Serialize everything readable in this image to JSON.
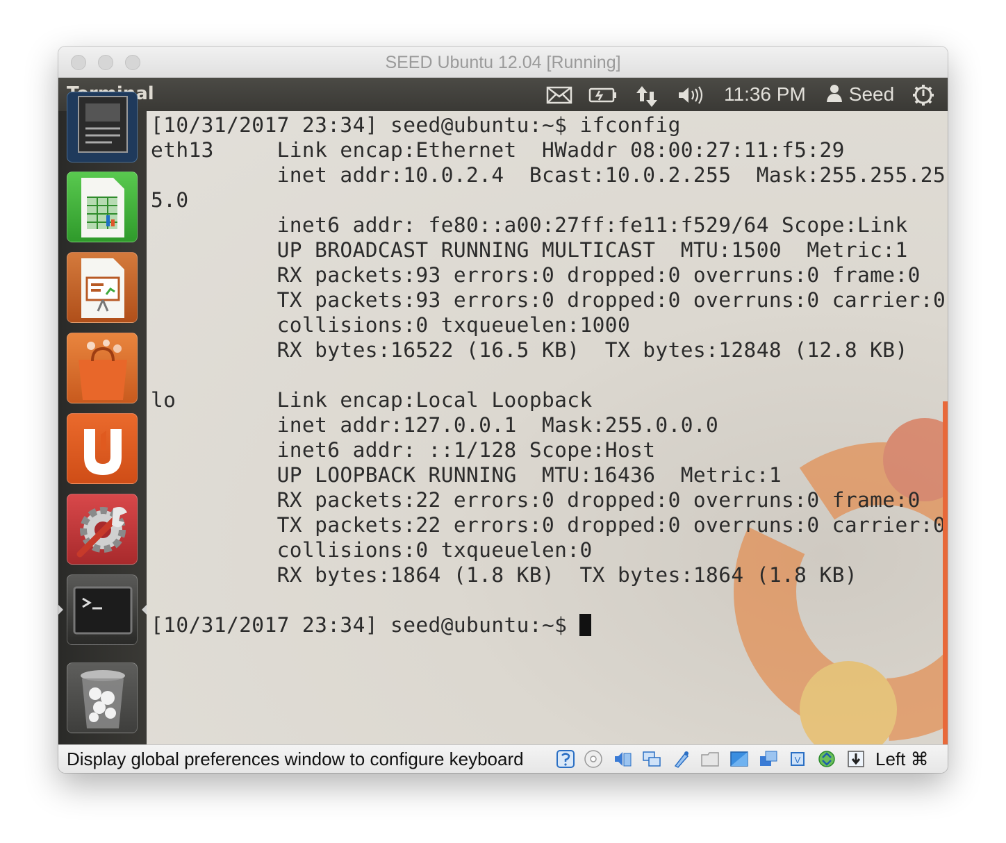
{
  "window": {
    "title": "SEED Ubuntu 12.04 [Running]"
  },
  "panel": {
    "app_title": "Terminal",
    "indicators": [
      "mail-icon",
      "battery-icon",
      "network-icon",
      "volume-icon"
    ],
    "clock": "11:36 PM",
    "user": "Seed",
    "session_icon": "power-gear-icon"
  },
  "launcher": {
    "items": [
      "document-viewer",
      "libreoffice-calc",
      "libreoffice-impress",
      "software-center",
      "ubuntu-one",
      "system-settings",
      "terminal",
      "trash"
    ],
    "colors": {
      "calc": "#3ea83b",
      "impress": "#c25b1f",
      "software": "#e36b22",
      "ubuntuone": "#e05a1f",
      "settings": "#c0393c"
    }
  },
  "terminal": {
    "lines": [
      "[10/31/2017 23:34] seed@ubuntu:~$ ifconfig",
      "eth13     Link encap:Ethernet  HWaddr 08:00:27:11:f5:29",
      "          inet addr:10.0.2.4  Bcast:10.0.2.255  Mask:255.255.25",
      "5.0",
      "          inet6 addr: fe80::a00:27ff:fe11:f529/64 Scope:Link",
      "          UP BROADCAST RUNNING MULTICAST  MTU:1500  Metric:1",
      "          RX packets:93 errors:0 dropped:0 overruns:0 frame:0",
      "          TX packets:93 errors:0 dropped:0 overruns:0 carrier:0",
      "          collisions:0 txqueuelen:1000",
      "          RX bytes:16522 (16.5 KB)  TX bytes:12848 (12.8 KB)",
      "",
      "lo        Link encap:Local Loopback",
      "          inet addr:127.0.0.1  Mask:255.0.0.0",
      "          inet6 addr: ::1/128 Scope:Host",
      "          UP LOOPBACK RUNNING  MTU:16436  Metric:1",
      "          RX packets:22 errors:0 dropped:0 overruns:0 frame:0",
      "          TX packets:22 errors:0 dropped:0 overruns:0 carrier:0",
      "          collisions:0 txqueuelen:0",
      "          RX bytes:1864 (1.8 KB)  TX bytes:1864 (1.8 KB)",
      ""
    ],
    "prompt": "[10/31/2017 23:34] seed@ubuntu:~$ "
  },
  "statusbar": {
    "message": "Display global preferences window to configure keyboard",
    "icons": [
      "keyboard-capture-icon",
      "optical-drive-icon",
      "audio-icon",
      "network-adapter-icon",
      "usb-icon",
      "shared-folder-icon",
      "display-icon",
      "video-capture-icon",
      "cpu-icon",
      "mouse-integration-icon",
      "host-key-arrow-icon"
    ],
    "host_key": "Left ⌘"
  }
}
